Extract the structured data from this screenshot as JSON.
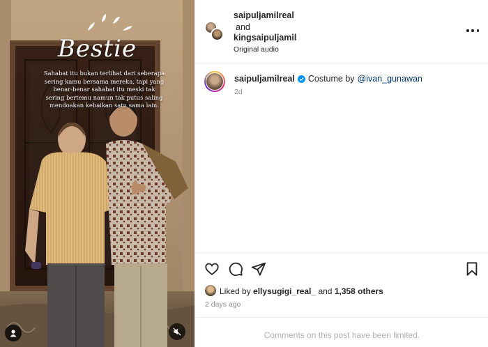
{
  "media": {
    "overlay_title": "Bestie",
    "overlay_caption": "Sahabat itu bukan terlihat dari seberapa sering kamu bersama mereka, tapi yang benar-benar sahabat itu meski tak sering bertemu namun tak putus saling mendoakan kebaikan satu sama lain."
  },
  "header": {
    "user1": "saipuljamilreal",
    "and_text": "and",
    "user2": "kingsaipuljamil",
    "audio": "Original audio"
  },
  "caption": {
    "username": "saipuljamilreal",
    "text": "Costume by",
    "mention": "@ivan_gunawan",
    "time": "2d"
  },
  "likes": {
    "prefix": "Liked by",
    "user": "ellysugigi_real_",
    "conj": "and",
    "count": "1,358 others"
  },
  "posted": "2 days ago",
  "comments_notice": "Comments on this post have been limited.",
  "colors": {
    "verified": "#0095f6",
    "mention": "#00376b",
    "muted_text": "#8e8e8e"
  }
}
